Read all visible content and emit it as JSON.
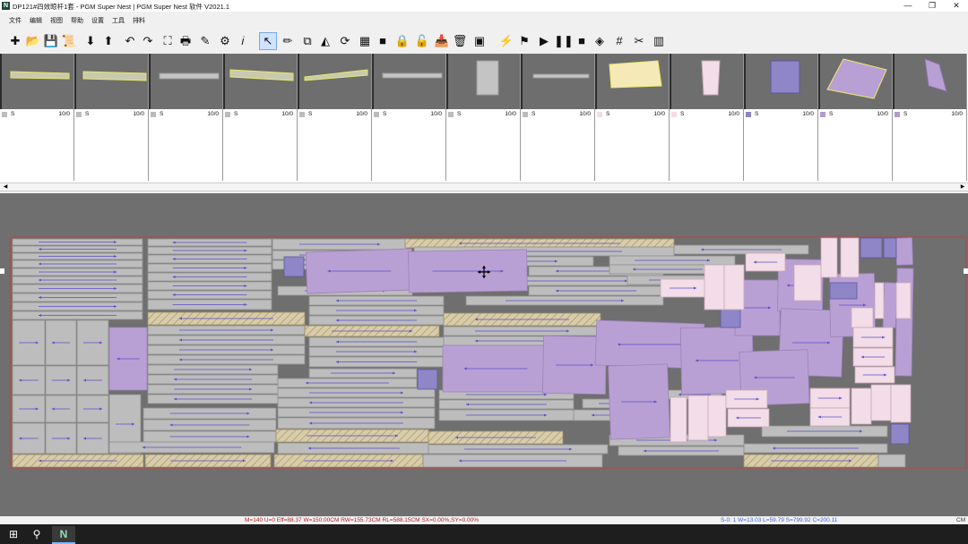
{
  "window": {
    "app_icon_letter": "N",
    "title": "DP121#四效晾杆1套 - PGM Super Nest | PGM Super Nest 软件 V2021.1",
    "minimize": "—",
    "maximize": "❐",
    "close": "✕"
  },
  "menu": [
    "文件",
    "编辑",
    "视图",
    "帮助",
    "设置",
    "工具",
    "排料"
  ],
  "toolbar_icons": [
    "new-icon",
    "open-icon",
    "save-icon",
    "export-icon",
    "import-down-icon",
    "import-up-icon",
    "undo-icon",
    "redo-icon",
    "fit-icon",
    "print-icon",
    "edit-icon",
    "settings-gear-icon",
    "info-icon",
    "select-arrow-icon",
    "measure-icon",
    "copy-icon",
    "mirror-icon",
    "rotate-icon",
    "grid-icon",
    "fill-icon",
    "lock-icon",
    "unlock-icon",
    "paste-icon",
    "delete-icon",
    "box-icon",
    "lightning-icon",
    "flag-icon",
    "play-icon",
    "pause-icon",
    "stop-icon",
    "layers-icon",
    "hash-grid-icon",
    "cut-icon",
    "barcode-icon"
  ],
  "toolbar_glyphs": [
    "✚",
    "📂",
    "💾",
    "📜",
    "⬇",
    "⬆",
    "↶",
    "↷",
    "⛶",
    "🖶",
    "✎",
    "⚙",
    "𝑖",
    "↖",
    "✏",
    "⧉",
    "◭",
    "⟳",
    "▦",
    "■",
    "🔒",
    "🔓",
    "📥",
    "🗑",
    "▣",
    "⚡",
    "⚑",
    "▶",
    "❚❚",
    "■",
    "◈",
    "#",
    "✂",
    "▥"
  ],
  "thumbnails": [
    {
      "size": "S",
      "count": "10/0",
      "swatch": "#bcbcbc"
    },
    {
      "size": "S",
      "count": "10/0",
      "swatch": "#bcbcbc"
    },
    {
      "size": "S",
      "count": "10/0",
      "swatch": "#bcbcbc"
    },
    {
      "size": "S",
      "count": "10/0",
      "swatch": "#bcbcbc"
    },
    {
      "size": "S",
      "count": "10/0",
      "swatch": "#bcbcbc"
    },
    {
      "size": "S",
      "count": "10/0",
      "swatch": "#bcbcbc"
    },
    {
      "size": "S",
      "count": "10/0",
      "swatch": "#bcbcbc"
    },
    {
      "size": "S",
      "count": "10/0",
      "swatch": "#bcbcbc"
    },
    {
      "size": "S",
      "count": "10/0",
      "swatch": "#f3dce6"
    },
    {
      "size": "S",
      "count": "10/0",
      "swatch": "#f3dce6"
    },
    {
      "size": "S",
      "count": "10/0",
      "swatch": "#8c84c4"
    },
    {
      "size": "S",
      "count": "10/0",
      "swatch": "#b49ad0"
    },
    {
      "size": "S",
      "count": "10/0",
      "swatch": "#b49ad0"
    }
  ],
  "status": {
    "left": "M=140  U=0  Eff=88.37  W=150.00CM  RW=155.73CM  RL=588.15CM  SX=0.00%,SY=0.00%",
    "right": "S-0: 1  W=13.03  L=59.79  S=799.92  C=200.11",
    "unit": "CM"
  },
  "taskbar": {
    "start": "⊞",
    "search": "⚲",
    "app": "N"
  },
  "colors": {
    "gray_piece": "#bdbdbd",
    "hatch_piece": "#d6cba6",
    "purple_piece": "#b9a0d4",
    "pink_piece": "#f3dde8",
    "blue_piece": "#8e86c6",
    "arrow": "#5b4ec9",
    "work_bg": "#6f6f6f"
  }
}
